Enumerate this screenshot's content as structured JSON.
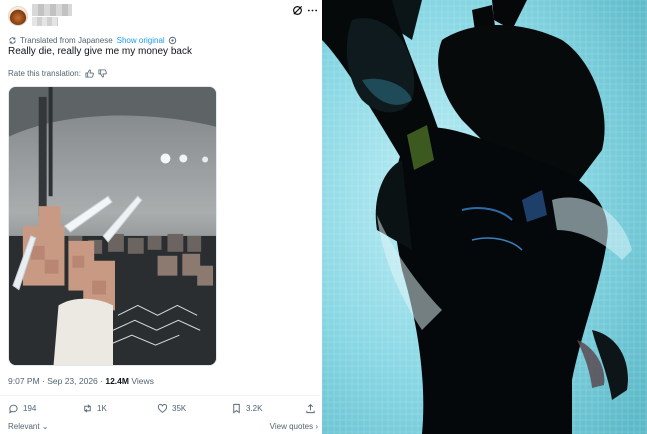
{
  "post": {
    "translation_note": "Translated from Japanese",
    "show_original": "Show original",
    "text": "Really die, really give me my money back",
    "rate_translation": "Rate this translation:",
    "timestamp": "9:07 PM · Sep 23, 2026 · ",
    "views_count": "12.4M",
    "views_label": " Views",
    "actions": {
      "replies": "194",
      "reposts": "1K",
      "likes": "35K",
      "bookmarks": "3.2K"
    },
    "sort_label": "Relevant ⌄",
    "view_quotes": "View quotes ›"
  },
  "icons": {
    "avatar": "avatar",
    "grok": "grok-icon",
    "more": "more-icon",
    "translate": "translate-icon",
    "settings": "settings-icon",
    "thumbs_up": "thumbs-up-icon",
    "thumbs_down": "thumbs-down-icon",
    "reply": "reply-icon",
    "repost": "repost-icon",
    "like": "heart-icon",
    "bookmark": "bookmark-icon",
    "share": "share-icon"
  },
  "colors": {
    "accent": "#1d9bf0",
    "text_primary": "#0f1419",
    "text_secondary": "#536471",
    "photo_backlight": "#7fd3e0"
  }
}
